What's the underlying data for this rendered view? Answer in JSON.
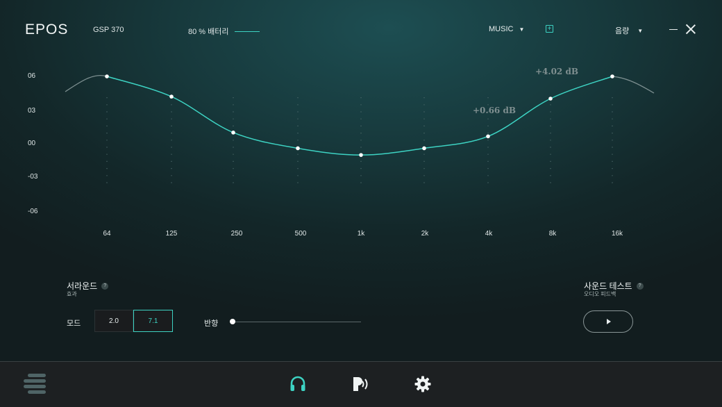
{
  "header": {
    "logo": "EPOS",
    "model": "GSP 370",
    "battery": "80 % 배터리",
    "preset": "MUSIC",
    "volume": "음량"
  },
  "equalizer": {
    "y_labels": [
      "06",
      "03",
      "00",
      "-03",
      "-06"
    ],
    "x_labels": [
      "64",
      "125",
      "250",
      "500",
      "1k",
      "2k",
      "4k",
      "8k",
      "16k"
    ],
    "annotations": [
      "+0.66 dB",
      "+4.02 dB"
    ],
    "curve_color": "#3dd3c3"
  },
  "chart_data": {
    "type": "line",
    "categories": [
      "64",
      "125",
      "250",
      "500",
      "1k",
      "2k",
      "4k",
      "8k",
      "16k"
    ],
    "values": [
      6.0,
      4.2,
      1.0,
      -0.4,
      -1.0,
      -0.4,
      0.66,
      4.02,
      6.0
    ],
    "ylim": [
      -6,
      6
    ],
    "grid": true,
    "annotations": [
      {
        "category": "4k",
        "text": "+0.66 dB"
      },
      {
        "category": "8k",
        "text": "+4.02 dB"
      }
    ]
  },
  "surround": {
    "title": "서라운드",
    "subtitle": "효과",
    "mode_label": "모드",
    "mode_options": [
      "2.0",
      "7.1"
    ],
    "selected_mode": "7.1",
    "direction_label": "반향",
    "direction_value": 0
  },
  "sound_test": {
    "title": "사운드 테스트",
    "subtitle": "오디오 피드백"
  },
  "nav": {
    "active": "headphones-icon",
    "items": [
      "headphones-icon",
      "sidetone-icon",
      "settings-icon"
    ],
    "accent": "#3dd3c3"
  }
}
